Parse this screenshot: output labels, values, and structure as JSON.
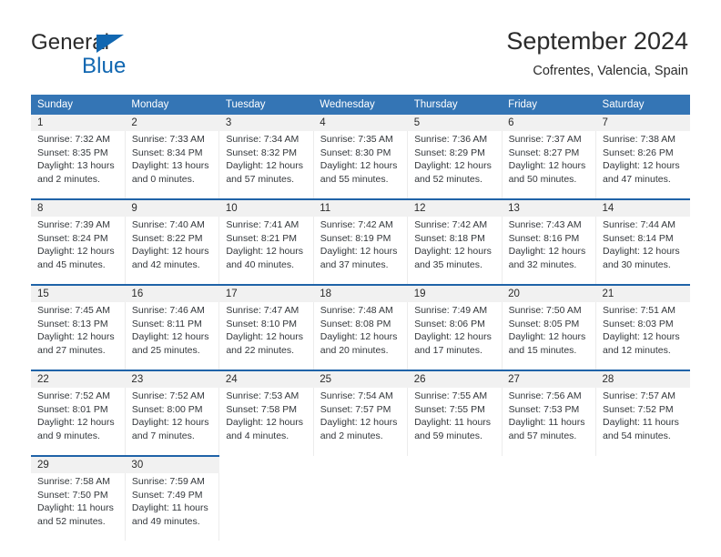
{
  "logo": {
    "word_one": "General",
    "word_two": "Blue",
    "triangle_icon": "triangle-icon",
    "brand_color": "#1167b1"
  },
  "header": {
    "title": "September 2024",
    "subtitle": "Cofrentes, Valencia, Spain"
  },
  "colors": {
    "header_blue": "#3475b5",
    "row_divider_blue": "#1f63a8",
    "daynum_background": "#f1f1f1",
    "text": "#2b2b2b"
  },
  "weekdays": [
    "Sunday",
    "Monday",
    "Tuesday",
    "Wednesday",
    "Thursday",
    "Friday",
    "Saturday"
  ],
  "weeks": [
    [
      {
        "day": "1",
        "sunrise": "Sunrise: 7:32 AM",
        "sunset": "Sunset: 8:35 PM",
        "daylight_line1": "Daylight: 13 hours",
        "daylight_line2": "and 2 minutes."
      },
      {
        "day": "2",
        "sunrise": "Sunrise: 7:33 AM",
        "sunset": "Sunset: 8:34 PM",
        "daylight_line1": "Daylight: 13 hours",
        "daylight_line2": "and 0 minutes."
      },
      {
        "day": "3",
        "sunrise": "Sunrise: 7:34 AM",
        "sunset": "Sunset: 8:32 PM",
        "daylight_line1": "Daylight: 12 hours",
        "daylight_line2": "and 57 minutes."
      },
      {
        "day": "4",
        "sunrise": "Sunrise: 7:35 AM",
        "sunset": "Sunset: 8:30 PM",
        "daylight_line1": "Daylight: 12 hours",
        "daylight_line2": "and 55 minutes."
      },
      {
        "day": "5",
        "sunrise": "Sunrise: 7:36 AM",
        "sunset": "Sunset: 8:29 PM",
        "daylight_line1": "Daylight: 12 hours",
        "daylight_line2": "and 52 minutes."
      },
      {
        "day": "6",
        "sunrise": "Sunrise: 7:37 AM",
        "sunset": "Sunset: 8:27 PM",
        "daylight_line1": "Daylight: 12 hours",
        "daylight_line2": "and 50 minutes."
      },
      {
        "day": "7",
        "sunrise": "Sunrise: 7:38 AM",
        "sunset": "Sunset: 8:26 PM",
        "daylight_line1": "Daylight: 12 hours",
        "daylight_line2": "and 47 minutes."
      }
    ],
    [
      {
        "day": "8",
        "sunrise": "Sunrise: 7:39 AM",
        "sunset": "Sunset: 8:24 PM",
        "daylight_line1": "Daylight: 12 hours",
        "daylight_line2": "and 45 minutes."
      },
      {
        "day": "9",
        "sunrise": "Sunrise: 7:40 AM",
        "sunset": "Sunset: 8:22 PM",
        "daylight_line1": "Daylight: 12 hours",
        "daylight_line2": "and 42 minutes."
      },
      {
        "day": "10",
        "sunrise": "Sunrise: 7:41 AM",
        "sunset": "Sunset: 8:21 PM",
        "daylight_line1": "Daylight: 12 hours",
        "daylight_line2": "and 40 minutes."
      },
      {
        "day": "11",
        "sunrise": "Sunrise: 7:42 AM",
        "sunset": "Sunset: 8:19 PM",
        "daylight_line1": "Daylight: 12 hours",
        "daylight_line2": "and 37 minutes."
      },
      {
        "day": "12",
        "sunrise": "Sunrise: 7:42 AM",
        "sunset": "Sunset: 8:18 PM",
        "daylight_line1": "Daylight: 12 hours",
        "daylight_line2": "and 35 minutes."
      },
      {
        "day": "13",
        "sunrise": "Sunrise: 7:43 AM",
        "sunset": "Sunset: 8:16 PM",
        "daylight_line1": "Daylight: 12 hours",
        "daylight_line2": "and 32 minutes."
      },
      {
        "day": "14",
        "sunrise": "Sunrise: 7:44 AM",
        "sunset": "Sunset: 8:14 PM",
        "daylight_line1": "Daylight: 12 hours",
        "daylight_line2": "and 30 minutes."
      }
    ],
    [
      {
        "day": "15",
        "sunrise": "Sunrise: 7:45 AM",
        "sunset": "Sunset: 8:13 PM",
        "daylight_line1": "Daylight: 12 hours",
        "daylight_line2": "and 27 minutes."
      },
      {
        "day": "16",
        "sunrise": "Sunrise: 7:46 AM",
        "sunset": "Sunset: 8:11 PM",
        "daylight_line1": "Daylight: 12 hours",
        "daylight_line2": "and 25 minutes."
      },
      {
        "day": "17",
        "sunrise": "Sunrise: 7:47 AM",
        "sunset": "Sunset: 8:10 PM",
        "daylight_line1": "Daylight: 12 hours",
        "daylight_line2": "and 22 minutes."
      },
      {
        "day": "18",
        "sunrise": "Sunrise: 7:48 AM",
        "sunset": "Sunset: 8:08 PM",
        "daylight_line1": "Daylight: 12 hours",
        "daylight_line2": "and 20 minutes."
      },
      {
        "day": "19",
        "sunrise": "Sunrise: 7:49 AM",
        "sunset": "Sunset: 8:06 PM",
        "daylight_line1": "Daylight: 12 hours",
        "daylight_line2": "and 17 minutes."
      },
      {
        "day": "20",
        "sunrise": "Sunrise: 7:50 AM",
        "sunset": "Sunset: 8:05 PM",
        "daylight_line1": "Daylight: 12 hours",
        "daylight_line2": "and 15 minutes."
      },
      {
        "day": "21",
        "sunrise": "Sunrise: 7:51 AM",
        "sunset": "Sunset: 8:03 PM",
        "daylight_line1": "Daylight: 12 hours",
        "daylight_line2": "and 12 minutes."
      }
    ],
    [
      {
        "day": "22",
        "sunrise": "Sunrise: 7:52 AM",
        "sunset": "Sunset: 8:01 PM",
        "daylight_line1": "Daylight: 12 hours",
        "daylight_line2": "and 9 minutes."
      },
      {
        "day": "23",
        "sunrise": "Sunrise: 7:52 AM",
        "sunset": "Sunset: 8:00 PM",
        "daylight_line1": "Daylight: 12 hours",
        "daylight_line2": "and 7 minutes."
      },
      {
        "day": "24",
        "sunrise": "Sunrise: 7:53 AM",
        "sunset": "Sunset: 7:58 PM",
        "daylight_line1": "Daylight: 12 hours",
        "daylight_line2": "and 4 minutes."
      },
      {
        "day": "25",
        "sunrise": "Sunrise: 7:54 AM",
        "sunset": "Sunset: 7:57 PM",
        "daylight_line1": "Daylight: 12 hours",
        "daylight_line2": "and 2 minutes."
      },
      {
        "day": "26",
        "sunrise": "Sunrise: 7:55 AM",
        "sunset": "Sunset: 7:55 PM",
        "daylight_line1": "Daylight: 11 hours",
        "daylight_line2": "and 59 minutes."
      },
      {
        "day": "27",
        "sunrise": "Sunrise: 7:56 AM",
        "sunset": "Sunset: 7:53 PM",
        "daylight_line1": "Daylight: 11 hours",
        "daylight_line2": "and 57 minutes."
      },
      {
        "day": "28",
        "sunrise": "Sunrise: 7:57 AM",
        "sunset": "Sunset: 7:52 PM",
        "daylight_line1": "Daylight: 11 hours",
        "daylight_line2": "and 54 minutes."
      }
    ],
    [
      {
        "day": "29",
        "sunrise": "Sunrise: 7:58 AM",
        "sunset": "Sunset: 7:50 PM",
        "daylight_line1": "Daylight: 11 hours",
        "daylight_line2": "and 52 minutes."
      },
      {
        "day": "30",
        "sunrise": "Sunrise: 7:59 AM",
        "sunset": "Sunset: 7:49 PM",
        "daylight_line1": "Daylight: 11 hours",
        "daylight_line2": "and 49 minutes."
      },
      {
        "day": "",
        "sunrise": "",
        "sunset": "",
        "daylight_line1": "",
        "daylight_line2": ""
      },
      {
        "day": "",
        "sunrise": "",
        "sunset": "",
        "daylight_line1": "",
        "daylight_line2": ""
      },
      {
        "day": "",
        "sunrise": "",
        "sunset": "",
        "daylight_line1": "",
        "daylight_line2": ""
      },
      {
        "day": "",
        "sunrise": "",
        "sunset": "",
        "daylight_line1": "",
        "daylight_line2": ""
      },
      {
        "day": "",
        "sunrise": "",
        "sunset": "",
        "daylight_line1": "",
        "daylight_line2": ""
      }
    ]
  ]
}
